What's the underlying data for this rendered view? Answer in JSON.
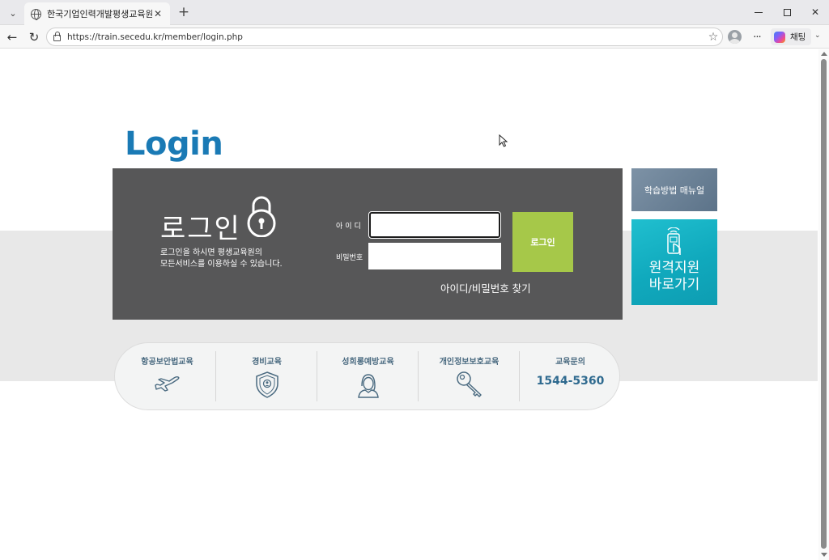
{
  "browser": {
    "tab_title": "한국기업인력개발평생교육원",
    "tab_close": "✕",
    "new_tab": "+",
    "url": "https://train.secedu.kr/member/login.php",
    "chat_label": "채팅"
  },
  "page": {
    "heading": "Login",
    "panel_title": "로그인",
    "desc_line1": "로그인을 하시면 평생교육원의",
    "desc_line2": "모든서비스를 이용하실 수 있습니다.",
    "id_label": "아이디",
    "pw_label": "비밀번호",
    "id_value": "",
    "pw_value": "",
    "login_button": "로그인",
    "find_link": "아이디/비밀번호 찾기",
    "manual_button": "학습방법 매뉴얼",
    "remote_line1": "원격지원",
    "remote_line2": "바로가기"
  },
  "quick_links": [
    {
      "label": "항공보안법교육",
      "icon": "airplane-icon"
    },
    {
      "label": "경비교육",
      "icon": "shield-icon"
    },
    {
      "label": "성희롱예방교육",
      "icon": "person-icon"
    },
    {
      "label": "개인정보보호교육",
      "icon": "key-icon"
    },
    {
      "label": "교육문의",
      "phone": "1544-5360"
    }
  ],
  "colors": {
    "heading_blue": "#1a7ab5",
    "panel_gray": "#575758",
    "login_green": "#a6c849",
    "remote_teal": "#10a9bd"
  }
}
